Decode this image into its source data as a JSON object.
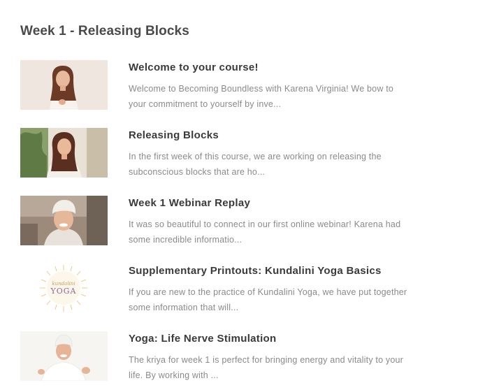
{
  "section": {
    "title": "Week 1 - Releasing Blocks"
  },
  "lessons": [
    {
      "title": "Welcome to your course!",
      "description": "Welcome to Becoming Boundless with Karena Virginia! We bow to your commitment to yourself by inve...",
      "thumbnail": "woman-in-white-room"
    },
    {
      "title": "Releasing Blocks",
      "description": "In the first week of this course, we are working on releasing the subconscious blocks that are ho...",
      "thumbnail": "woman-with-plants"
    },
    {
      "title": "Week 1 Webinar Replay",
      "description": "It was so beautiful to connect in our first online webinar! Karena had some incredible informatio...",
      "thumbnail": "woman-webinar-headwrap"
    },
    {
      "title": "Supplementary Printouts: Kundalini Yoga Basics",
      "description": "If you are new to the practice of Kundalini Yoga, we have put together some information that will...",
      "thumbnail": "kundalini-yoga-logo",
      "thumbnail_text": {
        "script": "kundalini",
        "word": "YOGA"
      }
    },
    {
      "title": "Yoga: Life Nerve Stimulation",
      "description": "The kriya for week 1 is perfect for bringing energy and vitality to your life. By working with ...",
      "thumbnail": "woman-teaching-yoga"
    }
  ],
  "colors": {
    "heading": "#4a4a4a",
    "title": "#3a3a3a",
    "description": "#8a8a8a",
    "logo_gold": "#d9a441"
  }
}
